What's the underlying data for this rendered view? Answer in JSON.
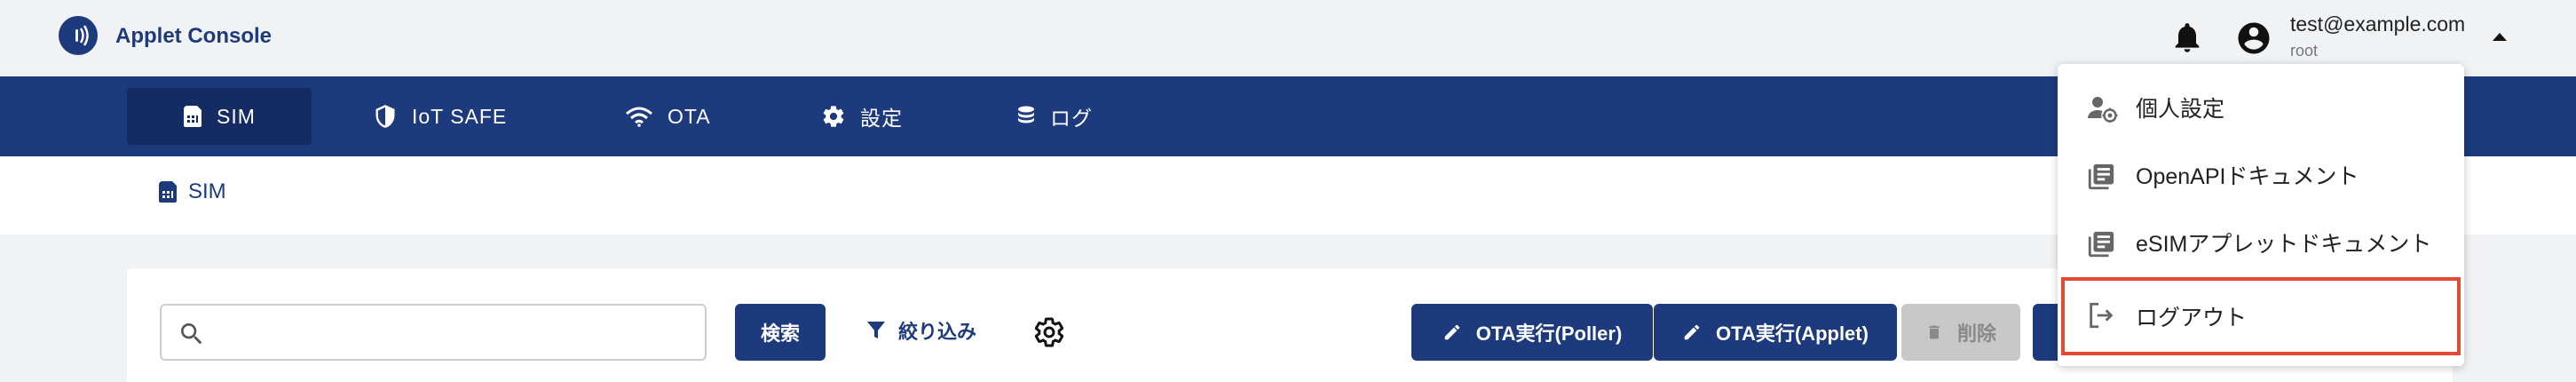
{
  "app": {
    "title": "Applet Console"
  },
  "user": {
    "email": "test@example.com",
    "role": "root"
  },
  "nav": {
    "items": [
      {
        "label": "SIM",
        "icon": "sim-card-icon",
        "active": true
      },
      {
        "label": "IoT SAFE",
        "icon": "shield-icon",
        "active": false
      },
      {
        "label": "OTA",
        "icon": "wifi-icon",
        "active": false
      },
      {
        "label": "設定",
        "icon": "gear-icon",
        "active": false
      },
      {
        "label": "ログ",
        "icon": "database-icon",
        "active": false
      }
    ]
  },
  "breadcrumb": {
    "label": "SIM",
    "icon": "sim-card-icon"
  },
  "toolbar": {
    "search_placeholder": "",
    "search_button": "検索",
    "filter_label": "絞り込み",
    "ota_poller_label": "OTA実行(Poller)",
    "ota_applet_label": "OTA実行(Applet)",
    "delete_label": "削除"
  },
  "user_menu": {
    "items": [
      {
        "label": "個人設定",
        "icon": "user-settings-icon"
      },
      {
        "label": "OpenAPIドキュメント",
        "icon": "library-books-icon"
      },
      {
        "label": "eSIMアプレットドキュメント",
        "icon": "library-books-icon"
      },
      {
        "label": "ログアウト",
        "icon": "logout-icon",
        "highlighted": true
      }
    ]
  },
  "colors": {
    "primary": "#1c3a7c",
    "nav_active": "#142c63",
    "background": "#f1f2f4",
    "highlight_border": "#e04b32",
    "disabled": "#c8c8c8"
  }
}
